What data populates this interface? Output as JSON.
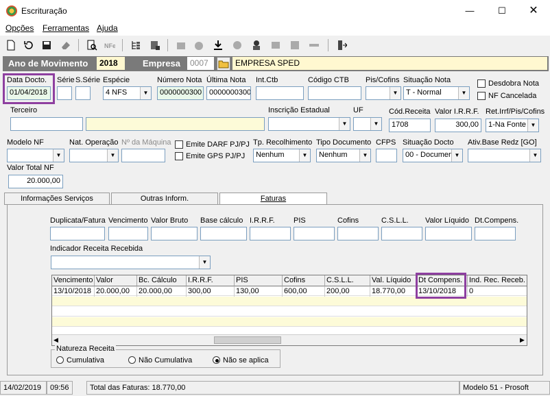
{
  "window": {
    "title": "Escrituração"
  },
  "menu": [
    "Opções",
    "Ferramentas",
    "Ajuda"
  ],
  "header": {
    "ano_label": "Ano de Movimento",
    "ano_value": "2018",
    "empresa_label": "Empresa",
    "empresa_code": "0007",
    "empresa_name": "EMPRESA SPED"
  },
  "row1": {
    "data_docto_label": "Data Docto.",
    "data_docto": "01/04/2018",
    "serie_label": "Série",
    "sserie_label": "S.Série",
    "especie_label": "Espécie",
    "especie": "4 NFS",
    "numero_nota_label": "Número Nota",
    "numero_nota": "0000000300",
    "ultima_nota_label": "Última Nota",
    "ultima_nota": "0000000300",
    "intctb_label": "Int.Ctb",
    "codigo_ctb_label": "Código CTB",
    "pis_cofins_label": "Pis/Cofins",
    "situacao_nota_label": "Situação Nota",
    "situacao_nota": "T - Normal",
    "desdobra_label": "Desdobra Nota",
    "nf_cancelada_label": "NF Cancelada"
  },
  "row2": {
    "terceiro_label": "Terceiro",
    "inscricao_label": "Inscrição Estadual",
    "uf_label": "UF",
    "cod_receita_label": "Cód.Receita",
    "cod_receita": "1708",
    "valor_irrf_label": "Valor I.R.R.F.",
    "valor_irrf": "300,00",
    "ret_label": "Ret.Irrf/Pis/Cofins",
    "ret_value": "1-Na Fonte"
  },
  "row3": {
    "modelo_label": "Modelo NF",
    "nat_label": "Nat. Operação",
    "maquina_label": "Nº da Máquina",
    "darf_label": "Emite DARF PJ/PJ",
    "gps_label": "Emite GPS PJ/PJ",
    "tp_rec_label": "Tp. Recolhimento",
    "tp_rec": "Nenhum",
    "tipo_doc_label": "Tipo Documento",
    "tipo_doc": "Nenhum",
    "cfps_label": "CFPS",
    "sit_docto_label": "Situação Docto",
    "sit_docto": "00 - Documen",
    "ativ_label": "Ativ.Base Redz [GO]"
  },
  "row4": {
    "valor_total_label": "Valor Total NF",
    "valor_total": "20.000,00"
  },
  "tabs": [
    "Informações Serviços",
    "Outras Inform.",
    "Faturas"
  ],
  "faturas": {
    "fields": [
      "Duplicata/Fatura",
      "Vencimento",
      "Valor Bruto",
      "Base cálculo",
      "I.R.R.F.",
      "PIS",
      "Cofins",
      "C.S.L.L.",
      "Valor Líquido",
      "Dt.Compens."
    ],
    "indicador_label": "Indicador Receita Recebida",
    "grid_headers": [
      "Vencimento",
      "Valor",
      "Bc. Cálculo",
      "I.R.R.F.",
      "PIS",
      "Cofins",
      "C.S.L.L.",
      "Val. Líquido",
      "Dt Compens.",
      "Ind. Rec. Receb."
    ],
    "grid_row": [
      "13/10/2018",
      "20.000,00",
      "20.000,00",
      "300,00",
      "130,00",
      "600,00",
      "200,00",
      "18.770,00",
      "13/10/2018",
      "0"
    ],
    "natureza_label": "Natureza Receita",
    "natureza_options": [
      "Cumulativa",
      "Não Cumulativa",
      "Não se aplica"
    ],
    "natureza_selected": "Não se aplica"
  },
  "status": {
    "date": "14/02/2019",
    "time": "09:56",
    "total": "Total das Faturas: 18.770,00",
    "model": "Modelo 51 - Prosoft"
  },
  "colors": {
    "highlight": "#8e3fa0",
    "header_bar": "#7a7a7a",
    "yellow_field": "#fdfbd8"
  }
}
